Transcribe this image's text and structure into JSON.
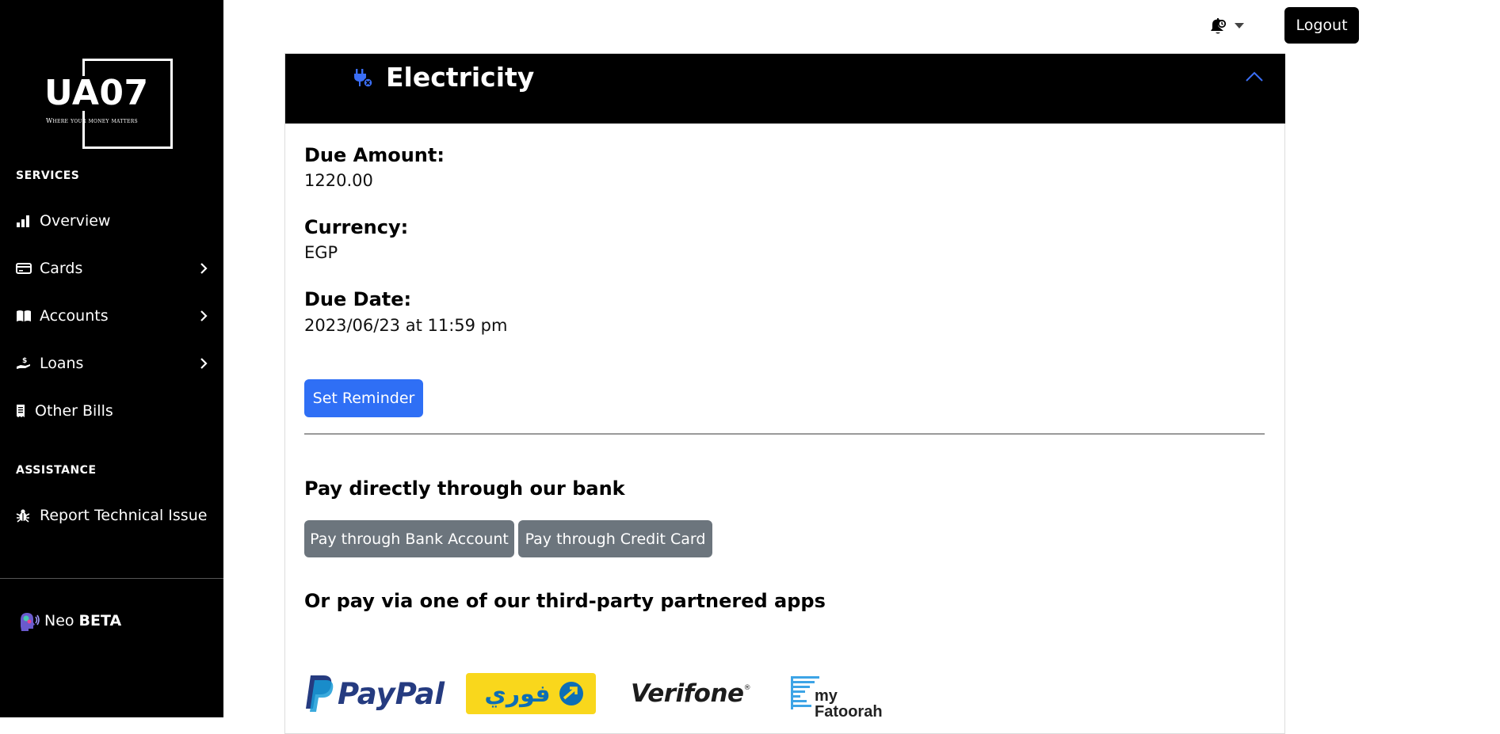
{
  "sidebar": {
    "logo": {
      "brand": "UA07",
      "tagline": "Where your money matters"
    },
    "services_label": "SERVICES",
    "items": [
      {
        "label": "Overview",
        "icon": "bar-chart-icon",
        "has_chevron": false
      },
      {
        "label": "Cards",
        "icon": "credit-card-icon",
        "has_chevron": true
      },
      {
        "label": "Accounts",
        "icon": "book-icon",
        "has_chevron": true
      },
      {
        "label": "Loans",
        "icon": "hand-dollar-icon",
        "has_chevron": true
      },
      {
        "label": "Other Bills",
        "icon": "receipt-icon",
        "has_chevron": false
      }
    ],
    "assistance_label": "ASSISTANCE",
    "assistance_items": [
      {
        "label": "Report Technical Issue",
        "icon": "bug-icon"
      }
    ],
    "neo": {
      "label": "Neo",
      "badge": "BETA",
      "icon": "ai-head-icon"
    }
  },
  "topbar": {
    "notification_icon": "bell-icon",
    "logout_label": "Logout"
  },
  "bill": {
    "title": "Electricity",
    "icon": "plug-icon",
    "fields": [
      {
        "label": "Due Amount:",
        "value": "1220.00"
      },
      {
        "label": "Currency:",
        "value": "EGP"
      },
      {
        "label": "Due Date:",
        "value": "2023/06/23 at 11:59 pm"
      }
    ],
    "reminder_label": "Set Reminder",
    "pay_direct_title": "Pay directly through our bank",
    "pay_bank_account_label": "Pay through Bank Account",
    "pay_credit_card_label": "Pay through Credit Card",
    "third_party_title": "Or pay via one of our third-party partnered apps",
    "partners": [
      {
        "name": "PayPal"
      },
      {
        "name": "فوري"
      },
      {
        "name": "Verifone"
      },
      {
        "name": "my",
        "name2": "Fatoorah"
      }
    ]
  },
  "colors": {
    "sidebar_bg": "#000000",
    "primary_button": "#2f6ff5",
    "secondary_button": "#6c757d",
    "paypal_dark": "#253b80",
    "paypal_light": "#179bd7",
    "fawry_yellow": "#f9d71c",
    "fawry_blue": "#0d6eb5",
    "myfatoorah_blue": "#3da4e6"
  }
}
